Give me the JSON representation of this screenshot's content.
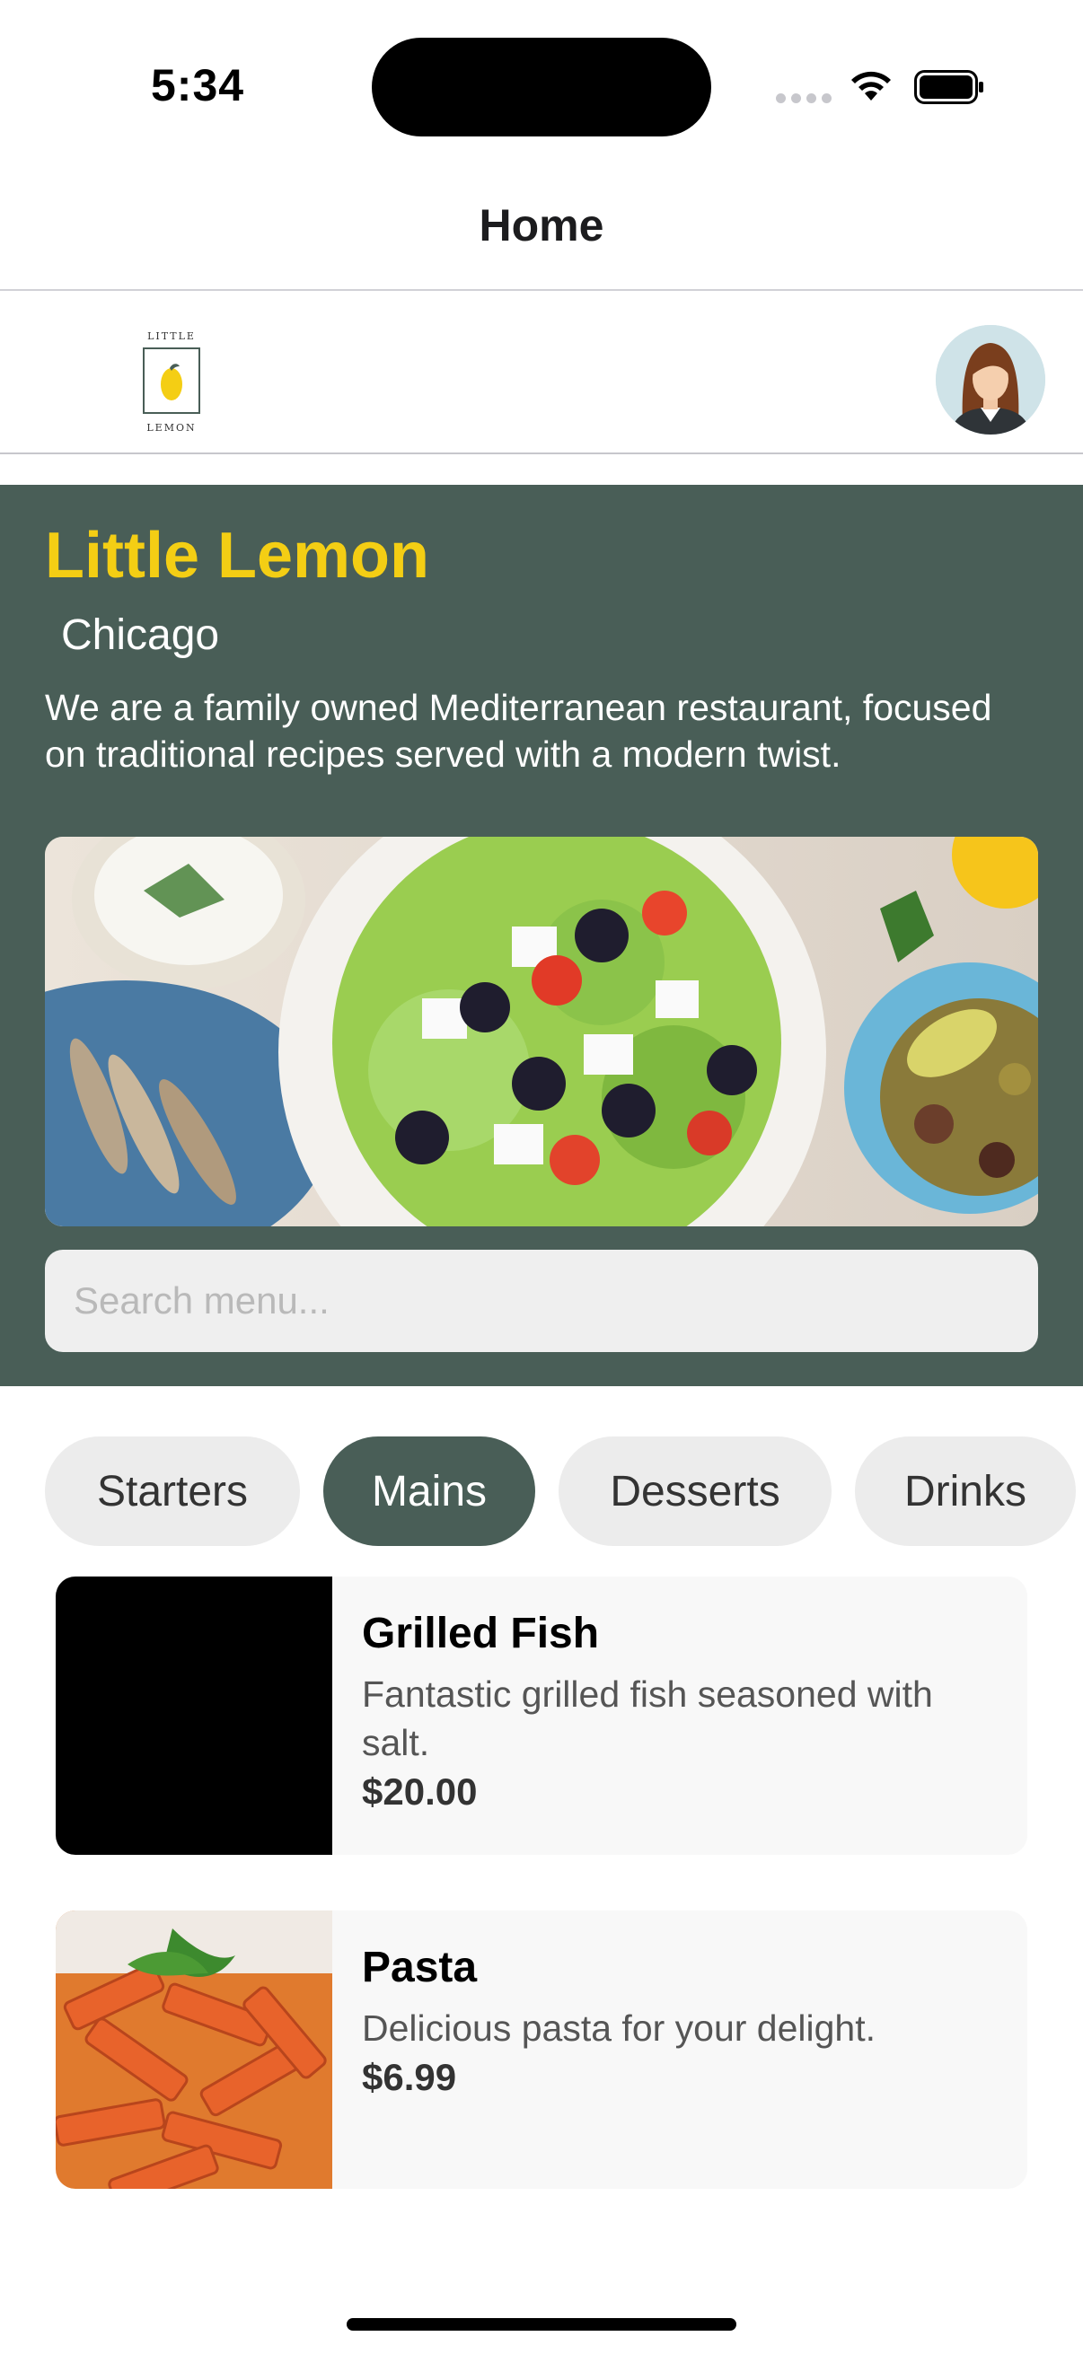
{
  "status_bar": {
    "time": "5:34"
  },
  "nav": {
    "title": "Home"
  },
  "hero": {
    "title": "Little Lemon",
    "city": "Chicago",
    "description": "We are a family owned Mediterranean restaurant, focused on traditional recipes served with a modern twist.",
    "image_icon": "mediterranean-food-photo",
    "search_placeholder": "Search menu...",
    "search_value": ""
  },
  "logo": {
    "top": "LITTLE",
    "bottom": "LEMON"
  },
  "categories": [
    {
      "label": "Starters",
      "active": false
    },
    {
      "label": "Mains",
      "active": true
    },
    {
      "label": "Desserts",
      "active": false
    },
    {
      "label": "Drinks",
      "active": false
    }
  ],
  "menu": [
    {
      "name": "Grilled Fish",
      "description": "Fantastic grilled fish seasoned with salt.",
      "price": "$20.00"
    },
    {
      "name": "Pasta",
      "description": "Delicious pasta for your delight.",
      "price": "$6.99"
    }
  ],
  "colors": {
    "primary": "#495e57",
    "accent": "#f4ce14"
  }
}
